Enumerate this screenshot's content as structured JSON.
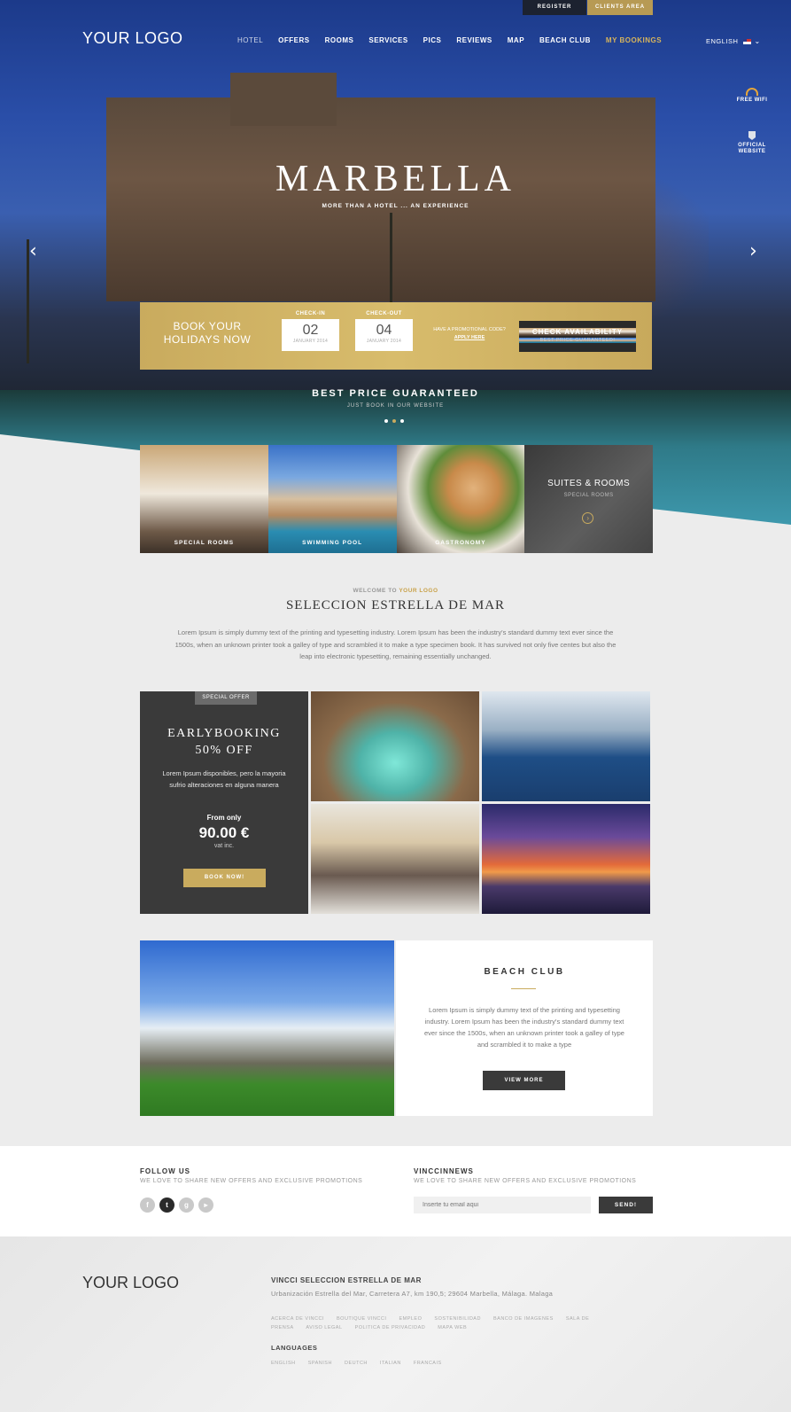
{
  "topbar": {
    "register": "REGISTER",
    "clients_area": "CLIENTS AREA"
  },
  "header": {
    "logo": "YOUR LOGO",
    "nav": [
      {
        "label": "HOTEL",
        "style": "muted"
      },
      {
        "label": "OFFERS",
        "style": "normal"
      },
      {
        "label": "ROOMS",
        "style": "normal"
      },
      {
        "label": "SERVICES",
        "style": "normal"
      },
      {
        "label": "PICS",
        "style": "normal"
      },
      {
        "label": "REVIEWS",
        "style": "normal"
      },
      {
        "label": "MAP",
        "style": "normal"
      },
      {
        "label": "BEACH CLUB",
        "style": "normal"
      },
      {
        "label": "MY BOOKINGS",
        "style": "gold"
      }
    ],
    "language": "ENGLISH"
  },
  "side": {
    "wifi": "FREE WIFI",
    "official_1": "OFFICIAL",
    "official_2": "WEBSITE"
  },
  "hero": {
    "title": "MARBELLA",
    "subtitle": "MORE THAN A HOTEL ... AN EXPERIENCE",
    "best_price": "BEST PRICE GUARANTEED",
    "best_price_sub": "JUST BOOK IN OUR WEBSITE"
  },
  "booking": {
    "title": "BOOK YOUR HOLIDAYS NOW",
    "checkin_label": "CHECK-IN",
    "checkin_day": "02",
    "checkin_month": "JANUARY 2014",
    "checkout_label": "CHECK-OUT",
    "checkout_day": "04",
    "checkout_month": "JANUARY 2014",
    "promo": "HAVE A PROMOTIONAL CODE?",
    "apply": "APPLY HERE",
    "btn": "CHECK AVAILABILITY",
    "btn_sub": "BEST PRICE GUARANTEED!"
  },
  "tiles": {
    "t1": "SPECIAL ROOMS",
    "t2": "SWIMMING POOL",
    "t3": "GASTRONOMY",
    "t4_title": "SUITES & ROOMS",
    "t4_sub": "SPECIAL ROOMS"
  },
  "welcome": {
    "small_prefix": "WELCOME TO",
    "small_logo": "YOUR LOGO",
    "title": "SELECCION ESTRELLA DE MAR",
    "text": "Lorem Ipsum is simply dummy text of the printing and typesetting industry. Lorem Ipsum has been the industry's standard dummy text ever since the 1500s, when an unknown printer took a galley of type and scrambled it to make a type specimen book. It has survived not only five centes but also the leap into electronic typesetting, remaining essentially unchanged."
  },
  "offer": {
    "badge": "SPECIAL OFFER",
    "title_1": "EARLYBOOKING",
    "title_2": "50% OFF",
    "text": "Lorem Ipsum disponibles, pero la mayoria sufrio alteraciones en alguna manera",
    "from": "From only",
    "price": "90.00 €",
    "vat": "vat inc.",
    "btn": "BOOK NOW!"
  },
  "beach": {
    "title": "BEACH CLUB",
    "text": "Lorem Ipsum is simply dummy text of the printing and typesetting industry. Lorem Ipsum has been the industry's standard dummy text ever since the 1500s, when an unknown printer took a galley of type and scrambled it to make a type",
    "btn": "VIEW MORE"
  },
  "news": {
    "follow": "FOLLOW US",
    "follow_sub": "WE LOVE TO SHARE NEW OFFERS AND EXCLUSIVE PROMOTIONS",
    "vincci": "VINCCINNEWS",
    "vincci_sub": "WE LOVE TO SHARE NEW OFFERS AND EXCLUSIVE PROMOTIONS",
    "email_placeholder": "Inserte tu email aqui",
    "send": "SEND!"
  },
  "footer": {
    "logo": "YOUR LOGO",
    "title": "VINCCI SELECCION ESTRELLA DE MAR",
    "address": "Urbanización Estrella del Mar, Carretera A7, km 190,5; 29604 Marbella, Málaga. Malaga",
    "links": [
      "ACERCA DE VINCCI",
      "BOUTIQUE VINCCI",
      "EMPLEO",
      "SOSTENIBILIDAD",
      "BANCO DE IMAGENES",
      "SALA DE PRENSA",
      "AVISO LEGAL",
      "POLITICA DE PRIVACIDAD",
      "MAPA WEB"
    ],
    "languages_title": "LANGUAGES",
    "languages": [
      "ENGLISH",
      "SPANISH",
      "DEUTCH",
      "ITALIAN",
      "FRANCAIS"
    ]
  }
}
